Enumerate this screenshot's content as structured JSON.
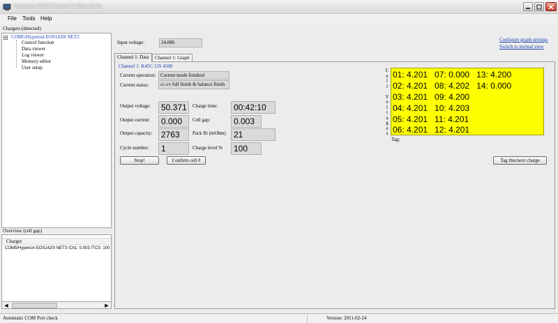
{
  "window": {
    "title": "Hyperion EOS Control & Data Suite"
  },
  "menu": [
    "File",
    "Tools",
    "Help"
  ],
  "chargers_panel": {
    "label": "Chargers (detected)",
    "root": "COM5/Hyperion EOS1420i NET3",
    "items": [
      "Control function",
      "Data viewer",
      "Log viewer",
      "Memory editor",
      "User setup"
    ]
  },
  "overview": {
    "label": "Overview (cell gap)",
    "column": "Charger",
    "row": "COM5/Hyperion EOS1420i NET3 /Ch1: 0.003 /TCS: 100"
  },
  "input_voltage": {
    "label": "Input voltage:",
    "value": "24.086"
  },
  "links": {
    "configure": "Configure graph settings",
    "switch": "Switch to normal view"
  },
  "tabs": [
    "Channel 1: Data",
    "Channel 1: Graph"
  ],
  "channel": {
    "header": "Channel 1: K45C 12S 4500",
    "current_operation": {
      "label": "Current operation:",
      "value": "Current mode finished"
    },
    "current_status": {
      "label": "Current status:",
      "value": "cc-cv full finish & balance finish"
    },
    "output_voltage": {
      "label": "Output voltage:",
      "value": "50.371"
    },
    "output_current": {
      "label": "Output current:",
      "value": "0.000"
    },
    "output_capacity": {
      "label": "Output capacity:",
      "value": "2763"
    },
    "cycle_number": {
      "label": "Cycle number:",
      "value": "1"
    },
    "charge_time": {
      "label": "Charge time:",
      "value": "00:42:10"
    },
    "cell_gap": {
      "label": "Cell gap:",
      "value": "0.003"
    },
    "pack_ri": {
      "label": "Pack Ri (mOhm)",
      "value": "21"
    },
    "charge_level": {
      "label": "Charge level %",
      "value": "100"
    }
  },
  "buttons": {
    "stop": "Stop!",
    "confirm": "Confirm cell #",
    "tag": "Tag this/next charge"
  },
  "cell_voltages": {
    "label_letters": [
      "C",
      "e",
      "l",
      "l",
      "",
      "V",
      "o",
      "l",
      "t",
      "a",
      "g",
      "e",
      "s"
    ],
    "rows": [
      "01: 4.201   07: 0.000   13: 4.200",
      "02: 4.201   08: 4.202   14: 0.000",
      "03: 4.201   09: 4.200",
      "04: 4.201   10: 4.203",
      "05: 4.201   11: 4.201",
      "06: 4.201   12: 4.201"
    ],
    "tag_label": "Tag:"
  },
  "status": {
    "left": "Automatic COM Port check",
    "version": "Version: 2011-02-24"
  }
}
